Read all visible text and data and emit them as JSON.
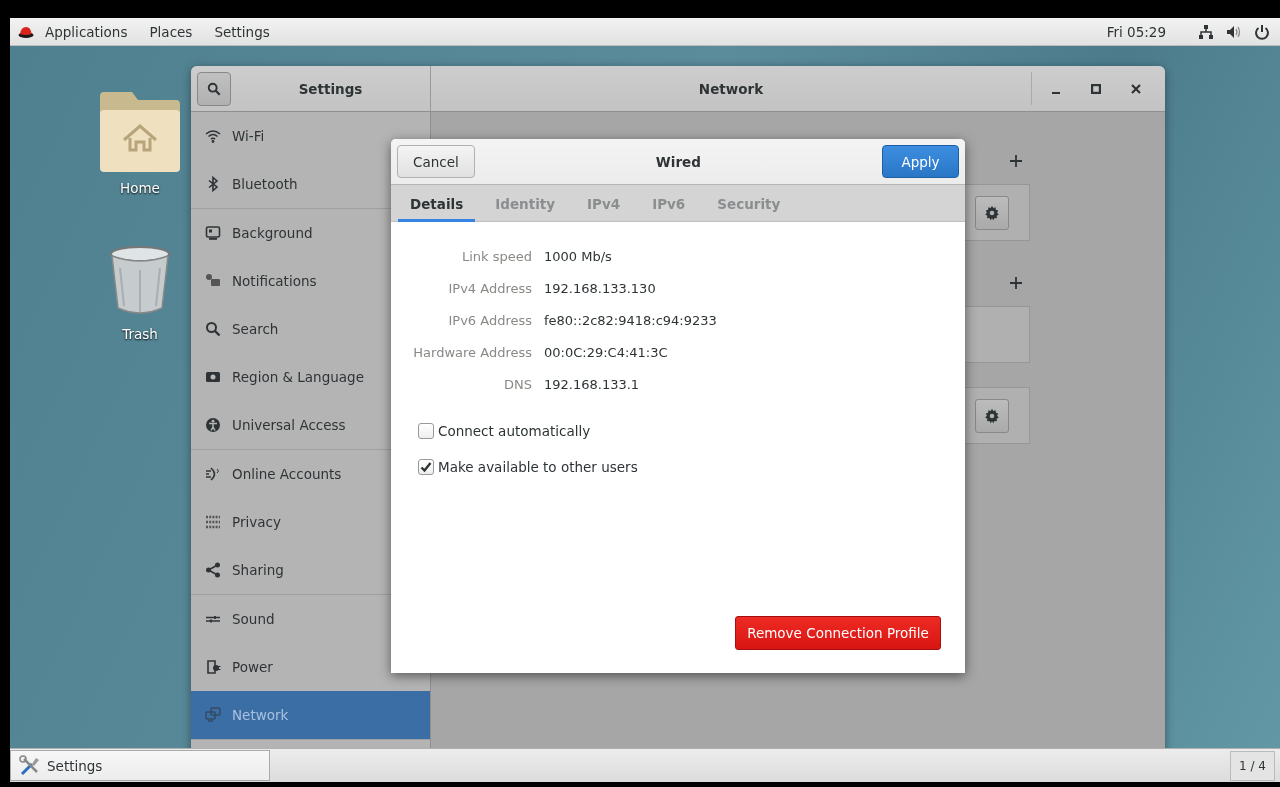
{
  "top_bar": {
    "menus": [
      "Applications",
      "Places",
      "Settings"
    ],
    "clock": "Fri 05:29"
  },
  "desktop_icons": [
    {
      "label": "Home",
      "kind": "folder"
    },
    {
      "label": "Trash",
      "kind": "trash"
    }
  ],
  "settings_window": {
    "sidebar_title": "Settings",
    "title": "Network",
    "sidebar": {
      "groups": [
        {
          "items": [
            {
              "label": "Wi-Fi",
              "selected": false
            },
            {
              "label": "Bluetooth",
              "selected": false
            }
          ]
        },
        {
          "items": [
            {
              "label": "Background",
              "selected": false
            },
            {
              "label": "Notifications",
              "selected": false
            },
            {
              "label": "Search",
              "selected": false
            },
            {
              "label": "Region & Language",
              "selected": false
            },
            {
              "label": "Universal Access",
              "selected": false
            }
          ]
        },
        {
          "items": [
            {
              "label": "Online Accounts",
              "selected": false
            },
            {
              "label": "Privacy",
              "selected": false
            },
            {
              "label": "Sharing",
              "selected": false
            }
          ]
        },
        {
          "items": [
            {
              "label": "Sound",
              "selected": false
            },
            {
              "label": "Power",
              "selected": false
            },
            {
              "label": "Network",
              "selected": true
            }
          ]
        }
      ]
    },
    "cards": [
      {
        "add_button": true,
        "kind": "gear"
      },
      {
        "add_button": true,
        "kind": "empty"
      },
      {
        "add_button": false,
        "kind": "gear"
      }
    ]
  },
  "dialog": {
    "title": "Wired",
    "cancel": "Cancel",
    "apply": "Apply",
    "tabs": [
      {
        "label": "Details",
        "selected": true
      },
      {
        "label": "Identity",
        "selected": false
      },
      {
        "label": "IPv4",
        "selected": false
      },
      {
        "label": "IPv6",
        "selected": false
      },
      {
        "label": "Security",
        "selected": false
      }
    ],
    "details": [
      {
        "label": "Link speed",
        "value": "1000 Mb/s"
      },
      {
        "label": "IPv4 Address",
        "value": "192.168.133.130"
      },
      {
        "label": "IPv6 Address",
        "value": "fe80::2c82:9418:c94:9233"
      },
      {
        "label": "Hardware Address",
        "value": "00:0C:29:C4:41:3C"
      },
      {
        "label": "DNS",
        "value": "192.168.133.1"
      }
    ],
    "checkboxes": [
      {
        "label": "Connect automatically",
        "checked": false
      },
      {
        "label": "Make available to other users",
        "checked": true
      }
    ],
    "remove_button": "Remove Connection Profile"
  },
  "taskbar": {
    "window_button": "Settings",
    "workspace": "1 / 4"
  }
}
